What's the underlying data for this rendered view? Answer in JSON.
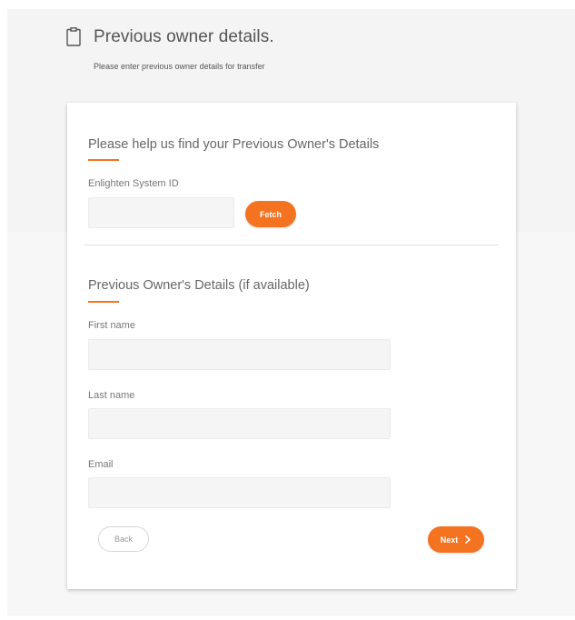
{
  "header": {
    "title": "Previous owner details.",
    "subtitle": "Please enter previous owner details for transfer",
    "icon": "clipboard-icon"
  },
  "lookup": {
    "title": "Please help us find your Previous Owner's Details",
    "system_id_label": "Enlighten System ID",
    "system_id_value": "",
    "fetch_label": "Fetch"
  },
  "owner": {
    "title": "Previous Owner's Details (if available)",
    "first_name_label": "First name",
    "first_name_value": "",
    "last_name_label": "Last name",
    "last_name_value": "",
    "email_label": "Email",
    "email_value": ""
  },
  "nav": {
    "back_label": "Back",
    "next_label": "Next",
    "next_icon": "chevron-right-icon"
  },
  "colors": {
    "accent": "#f37321",
    "input_bg": "#f5f5f5",
    "page_bg": "#f4f4f4"
  }
}
